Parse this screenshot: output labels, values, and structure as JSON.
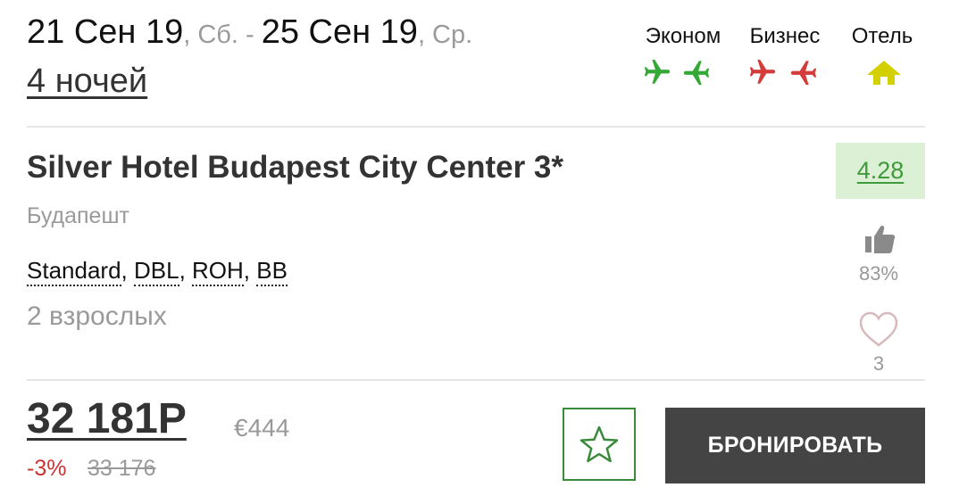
{
  "trip": {
    "date_from": "21 Сен 19",
    "day_from": ", Сб. - ",
    "date_to": "25 Сен 19",
    "day_to": ", Ср.",
    "nights": "4 ночей"
  },
  "classes": {
    "economy": "Эконом",
    "business": "Бизнес",
    "hotel": "Отель"
  },
  "icons": {
    "economy": "plane-icon",
    "business": "plane-icon",
    "hotel": "home-icon"
  },
  "colors": {
    "economy": "#35a936",
    "business": "#d43b3b",
    "hotel": "#d4d000",
    "rating_bg": "#dbf0d4",
    "button": "#444444"
  },
  "hotel": {
    "name": "Silver Hotel Budapest City Center 3*",
    "city": "Будапешт",
    "room": [
      "Standard",
      "DBL",
      "ROH",
      "BB"
    ],
    "guests": "2 взрослых",
    "rating": "4.28",
    "recommend_pct": "83%",
    "likes": "3"
  },
  "price": {
    "current": "32 181Р",
    "eur": "€444",
    "discount": "-3%",
    "old": "33 176"
  },
  "actions": {
    "book": "БРОНИРОВАТЬ"
  }
}
